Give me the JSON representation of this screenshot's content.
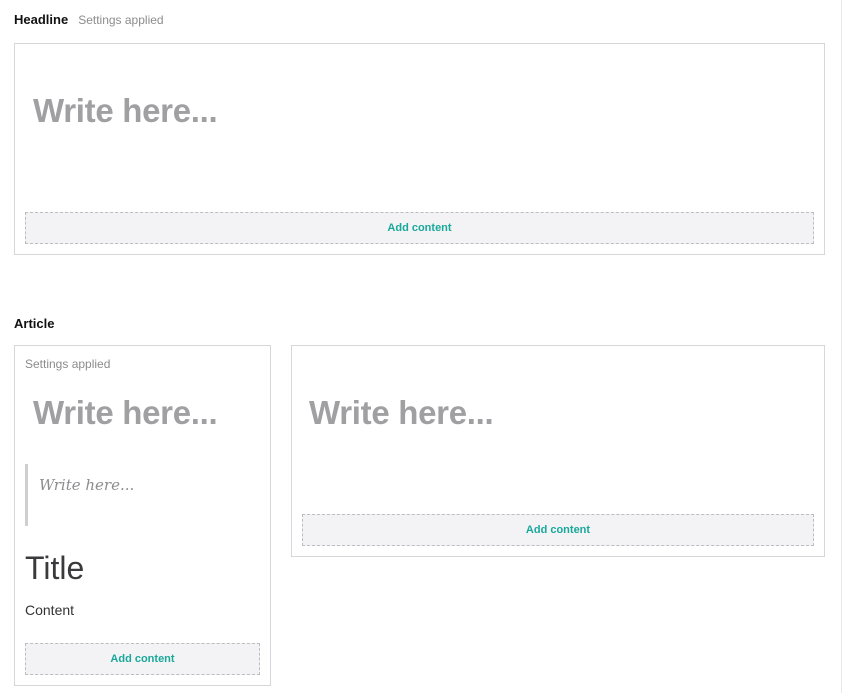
{
  "headline_section": {
    "title": "Headline",
    "settings_label": "Settings applied",
    "placeholder": "Write here...",
    "add_content_label": "Add content"
  },
  "article_section": {
    "title": "Article",
    "left_column": {
      "settings_label": "Settings applied",
      "heading_placeholder": "Write here...",
      "quote_placeholder": "Write here...",
      "title_text": "Title",
      "content_text": "Content",
      "add_content_label": "Add content"
    },
    "right_column": {
      "heading_placeholder": "Write here...",
      "add_content_label": "Add content"
    }
  },
  "colors": {
    "accent": "#1aa89b",
    "placeholder": "#a0a0a3",
    "border": "#d7d7d9",
    "add_content_bg": "#f3f3f5"
  }
}
